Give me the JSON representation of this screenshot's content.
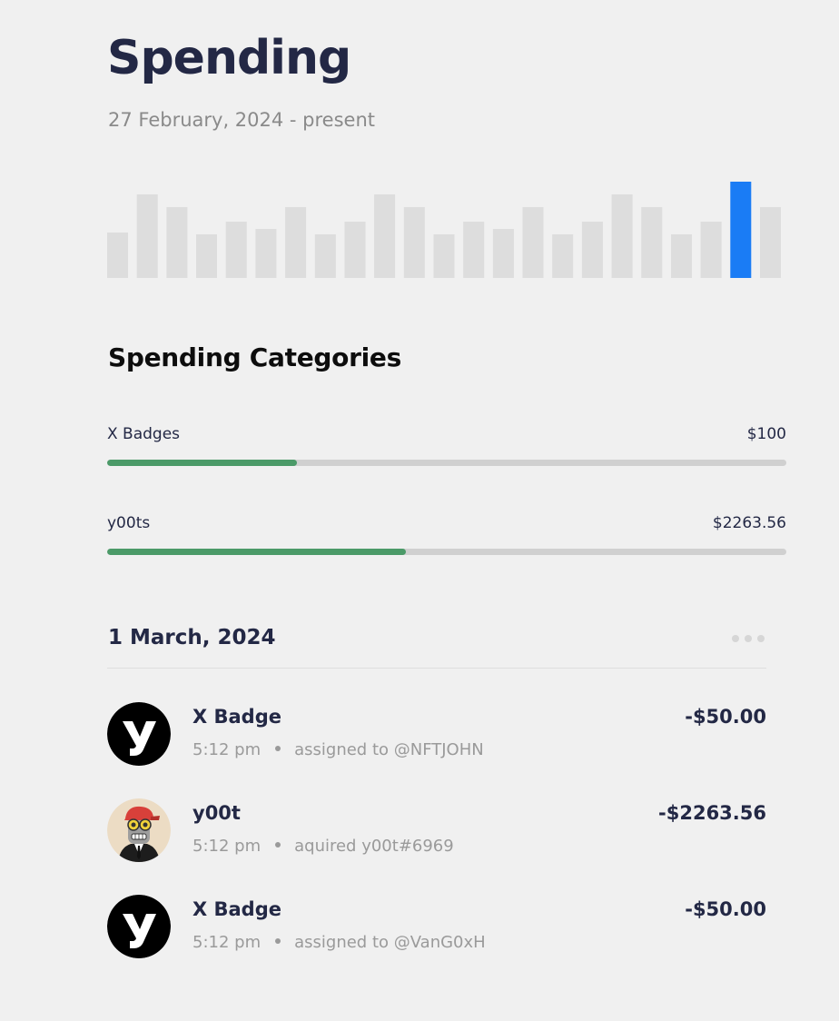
{
  "header": {
    "title": "Spending",
    "date_range": "27 February, 2024 - present"
  },
  "chart_data": {
    "type": "bar",
    "bar_count": 23,
    "values": [
      50,
      92,
      78,
      48,
      62,
      54,
      78,
      48,
      62,
      92,
      78,
      48,
      62,
      54,
      78,
      48,
      62,
      92,
      78,
      48,
      62,
      106,
      78
    ],
    "highlighted_index": 21,
    "colors": {
      "default": "#dddddd",
      "highlight": "#1a7cf5"
    },
    "title": "",
    "xlabel": "",
    "ylabel": ""
  },
  "categories": {
    "title": "Spending Categories",
    "items": [
      {
        "label": "X Badges",
        "amount": "$100",
        "progress": 0.28,
        "color": "#4b9a68"
      },
      {
        "label": "y00ts",
        "amount": "$2263.56",
        "progress": 0.44,
        "color": "#4b9a68"
      }
    ]
  },
  "activity": {
    "date": "1 March, 2024",
    "transactions": [
      {
        "icon": "y-logo-icon",
        "title": "X Badge",
        "amount": "-$50.00",
        "time": "5:12 pm",
        "detail": "assigned to @NFTJOHN"
      },
      {
        "icon": "y00t-avatar-icon",
        "title": "y00t",
        "amount": "-$2263.56",
        "time": "5:12 pm",
        "detail": "aquired y00t#6969"
      },
      {
        "icon": "y-logo-icon",
        "title": "X Badge",
        "amount": "-$50.00",
        "time": "5:12 pm",
        "detail": "assigned to @VanG0xH"
      }
    ]
  }
}
